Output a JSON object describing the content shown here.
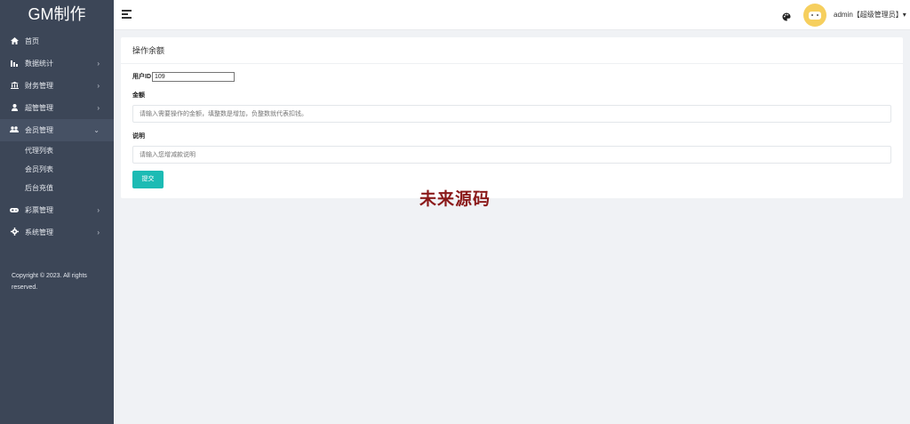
{
  "sidebar": {
    "brand": "GM制作",
    "items": [
      {
        "label": "首页",
        "icon": "home-icon",
        "arrow": ""
      },
      {
        "label": "数据统计",
        "icon": "bar-chart-icon",
        "arrow": "›"
      },
      {
        "label": "财务管理",
        "icon": "bank-icon",
        "arrow": "›"
      },
      {
        "label": "超管管理",
        "icon": "user-icon",
        "arrow": "›"
      },
      {
        "label": "会员管理",
        "icon": "users-icon",
        "arrow": "⌄"
      },
      {
        "label": "彩票管理",
        "icon": "gamepad-icon",
        "arrow": "›"
      },
      {
        "label": "系统管理",
        "icon": "gear-icon",
        "arrow": "›"
      }
    ],
    "sub_items": [
      "代理列表",
      "会员列表",
      "后台充值"
    ],
    "copyright": "Copyright © 2023. All rights reserved."
  },
  "topbar": {
    "user": "admin【超级管理员】▾"
  },
  "card": {
    "title": "操作余额",
    "user_id_label": "用户ID",
    "user_id_value": "109",
    "amount_label": "金额",
    "amount_placeholder": "请输入需要操作的金额，填整数是增加，负整数就代表扣钱。",
    "desc_label": "说明",
    "desc_placeholder": "请输入您增减款说明",
    "submit_label": "提交"
  },
  "watermark": "未来源码",
  "colors": {
    "sidebar_bg": "#3c4657",
    "accent": "#1cbbb4",
    "watermark": "#8b1a1a"
  }
}
